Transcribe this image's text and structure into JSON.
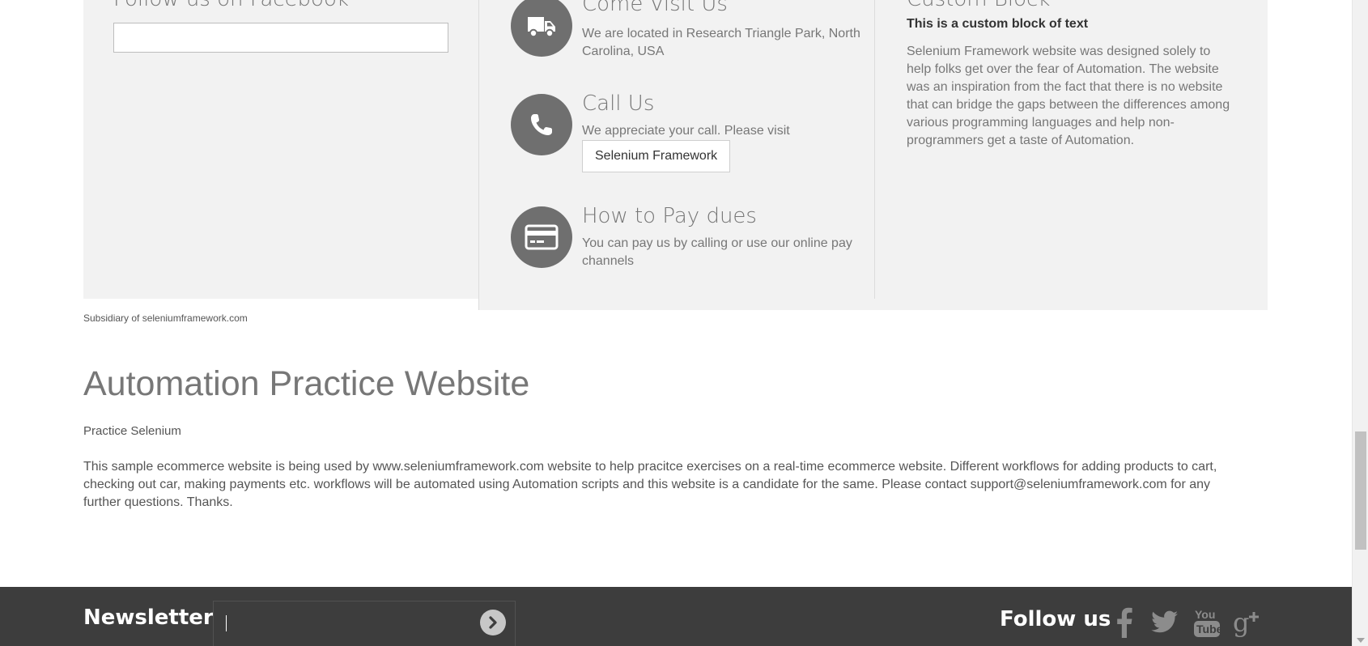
{
  "facebook_block": {
    "title": "Follow us on Facebook"
  },
  "info_block": {
    "items": [
      {
        "icon": "truck-icon",
        "heading": "Come Visit Us",
        "text": "We are located in Research Triangle Park, North Carolina, USA"
      },
      {
        "icon": "phone-icon",
        "heading": "Call Us",
        "text": "We appreciate your call. Please visit",
        "button_label": "Selenium Framework"
      },
      {
        "icon": "credit-card-icon",
        "heading": "How to Pay dues",
        "text": "You can pay us by calling or use our online pay channels"
      }
    ]
  },
  "custom_block": {
    "title": "Custom Block",
    "subtitle": "This is a custom block of text",
    "text": "Selenium Framework website was designed solely to help folks get over the fear of Automation. The website was an inspiration from the fact that there is no website that can bridge the gaps between the differences among various programming languages and help non-programmers get a taste of Automation."
  },
  "subsidiary": "Subsidiary of seleniumframework.com",
  "cms": {
    "title": "Automation Practice Website",
    "subtitle": "Practice Selenium",
    "text": "This sample ecommerce website is being used by www.seleniumframework.com website to help pracitce exercises on a real-time ecommerce website. Different workflows for adding products to cart, checking out car, making payments etc. workflows will be automated using Automation scripts and this website is a candidate for the same. Please contact support@seleniumframework.com for any further questions. Thanks."
  },
  "newsletter": {
    "title": "Newsletter",
    "input_value": "",
    "submit_icon": "chevron-right-circle-icon"
  },
  "follow": {
    "title": "Follow us",
    "networks": [
      "facebook-icon",
      "twitter-icon",
      "youtube-icon",
      "google-plus-icon"
    ]
  },
  "colors": {
    "panel_bg": "#f2f2f2",
    "icon_bg": "#6f6f6f",
    "dark_bar": "#3d3d3d",
    "text_gray": "#777777"
  }
}
